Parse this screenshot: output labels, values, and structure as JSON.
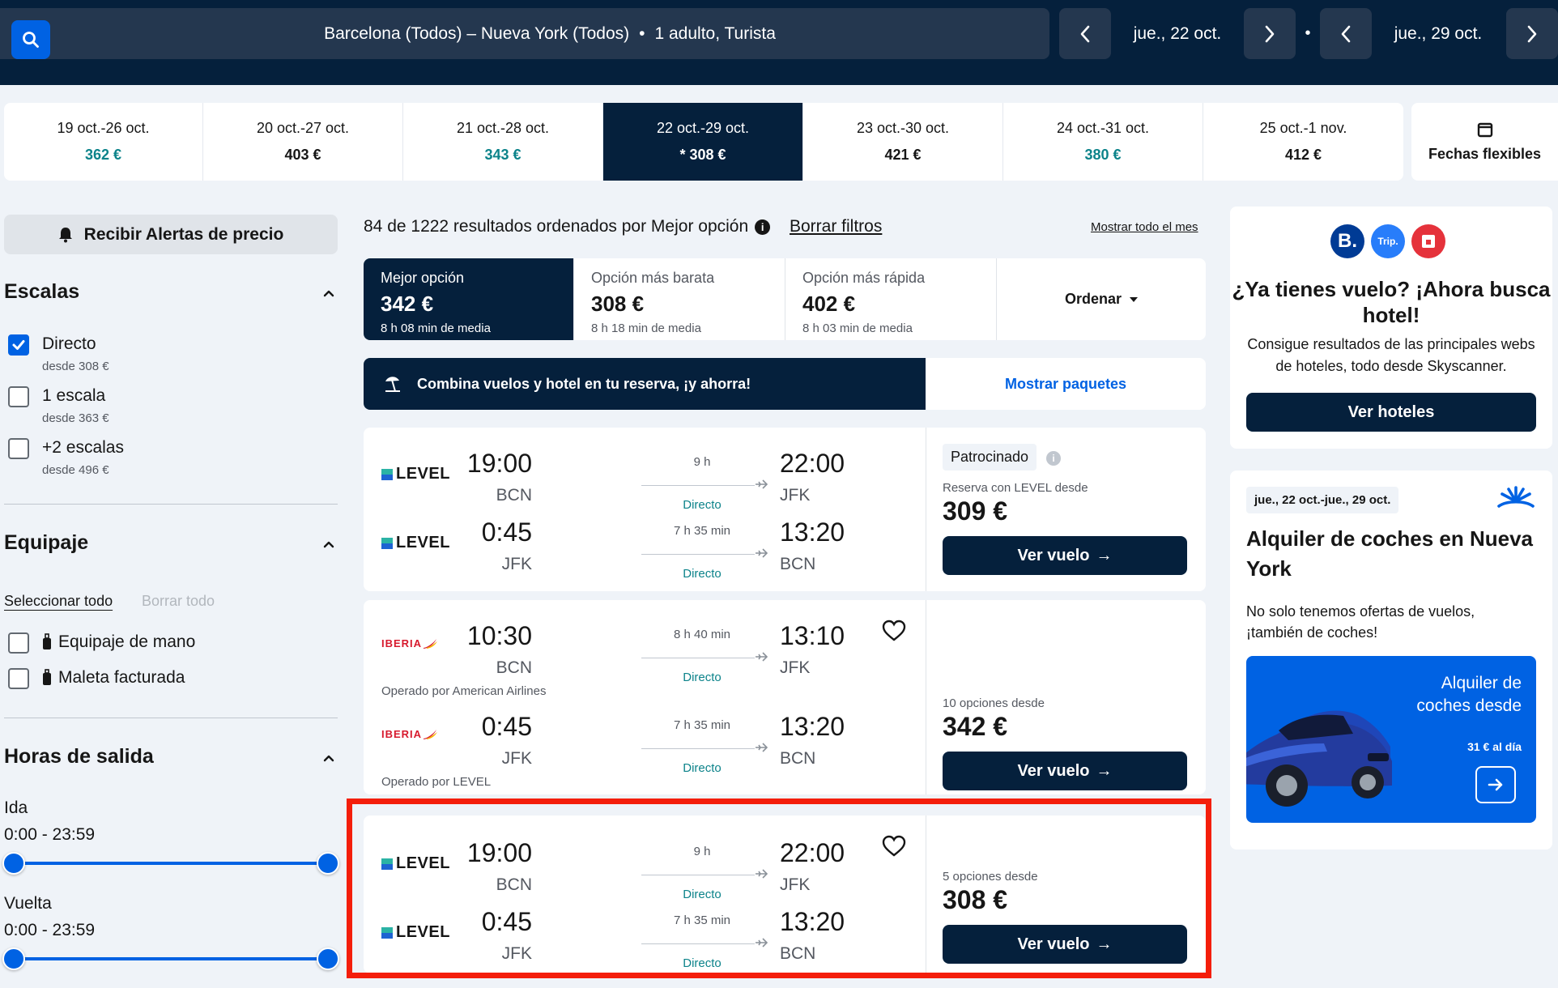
{
  "header": {
    "search_summary": "Barcelona (Todos) – Nueva York (Todos)",
    "dot": "•",
    "travellers": "1 adulto, Turista",
    "outbound_date": "jue., 22 oct.",
    "return_date": "jue., 29 oct.",
    "separator": "•"
  },
  "date_strip": [
    {
      "range": "19 oct.-26 oct.",
      "price": "362 €",
      "color": "green"
    },
    {
      "range": "20 oct.-27 oct.",
      "price": "403 €",
      "color": "black"
    },
    {
      "range": "21 oct.-28 oct.",
      "price": "343 €",
      "color": "green"
    },
    {
      "range": "22 oct.-29 oct.",
      "price": "* 308 €",
      "color": "selected"
    },
    {
      "range": "23 oct.-30 oct.",
      "price": "421 €",
      "color": "black"
    },
    {
      "range": "24 oct.-31 oct.",
      "price": "380 €",
      "color": "green"
    },
    {
      "range": "25 oct.-1 nov.",
      "price": "412 €",
      "color": "black"
    }
  ],
  "flexible_dates": "Fechas flexibles",
  "sidebar": {
    "price_alerts": "Recibir Alertas de precio",
    "stops_title": "Escalas",
    "stops": [
      {
        "label": "Directo",
        "from": "desde 308 €",
        "checked": true
      },
      {
        "label": "1 escala",
        "from": "desde 363 €",
        "checked": false
      },
      {
        "label": "+2 escalas",
        "from": "desde 496 €",
        "checked": false
      }
    ],
    "baggage_title": "Equipaje",
    "select_all": "Seleccionar todo",
    "clear_all": "Borrar todo",
    "baggage": [
      {
        "label": "Equipaje de mano"
      },
      {
        "label": "Maleta facturada"
      }
    ],
    "times_title": "Horas de salida",
    "outbound_label": "Ida",
    "outbound_range": "0:00 - 23:59",
    "return_label": "Vuelta",
    "return_range": "0:00 - 23:59"
  },
  "results": {
    "count_text": "84 de 1222 resultados ordenados por Mejor opción",
    "clear_filters": "Borrar filtros",
    "show_month": "Mostrar todo el mes",
    "sort_tabs": [
      {
        "title": "Mejor opción",
        "price": "342 €",
        "sub": "8 h 08 min de media"
      },
      {
        "title": "Opción más barata",
        "price": "308 €",
        "sub": "8 h 18 min de media"
      },
      {
        "title": "Opción más rápida",
        "price": "402 €",
        "sub": "8 h 03 min de media"
      }
    ],
    "order_label": "Ordenar",
    "package_text": "Combina vuelos y hotel en tu reserva, ¡y ahorra!",
    "package_link": "Mostrar paquetes"
  },
  "cards": [
    {
      "legs": [
        {
          "airline": "LEVEL",
          "dep_time": "19:00",
          "dep_code": "BCN",
          "duration": "9 h",
          "stops": "Directo",
          "arr_time": "22:00",
          "arr_code": "JFK"
        },
        {
          "airline": "LEVEL",
          "dep_time": "0:45",
          "dep_code": "JFK",
          "duration": "7 h 35 min",
          "stops": "Directo",
          "arr_time": "13:20",
          "arr_code": "BCN"
        }
      ],
      "sponsored": "Patrocinado",
      "sponsor_info": "i",
      "price_caption": "Reserva con LEVEL desde",
      "price": "309 €",
      "button": "Ver vuelo"
    },
    {
      "legs": [
        {
          "airline": "IBERIA",
          "dep_time": "10:30",
          "dep_code": "BCN",
          "duration": "8 h 40 min",
          "stops": "Directo",
          "arr_time": "13:10",
          "arr_code": "JFK",
          "operated": "Operado por American Airlines"
        },
        {
          "airline": "IBERIA",
          "dep_time": "0:45",
          "dep_code": "JFK",
          "duration": "7 h 35 min",
          "stops": "Directo",
          "arr_time": "13:20",
          "arr_code": "BCN",
          "operated": "Operado por LEVEL"
        }
      ],
      "price_caption": "10 opciones desde",
      "price": "342 €",
      "button": "Ver vuelo"
    },
    {
      "legs": [
        {
          "airline": "LEVEL",
          "dep_time": "19:00",
          "dep_code": "BCN",
          "duration": "9 h",
          "stops": "Directo",
          "arr_time": "22:00",
          "arr_code": "JFK"
        },
        {
          "airline": "LEVEL",
          "dep_time": "0:45",
          "dep_code": "JFK",
          "duration": "7 h 35 min",
          "stops": "Directo",
          "arr_time": "13:20",
          "arr_code": "BCN"
        }
      ],
      "price_caption": "5 opciones desde",
      "price": "308 €",
      "button": "Ver vuelo"
    }
  ],
  "hotel_promo": {
    "logo_b": "B.",
    "logo_trip": "Trip.",
    "title": "¿Ya tienes vuelo? ¡Ahora busca hotel!",
    "subtitle": "Consigue resultados de las principales webs de hoteles, todo desde Skyscanner.",
    "button": "Ver hoteles"
  },
  "car_promo": {
    "dates": "jue., 22 oct.-jue., 29 oct.",
    "title": "Alquiler de coches en Nueva York",
    "subtitle": "No solo tenemos ofertas de vuelos, ¡también de coches!",
    "promo_title": "Alquiler de coches desde",
    "promo_price": "31 € al día"
  },
  "colors": {
    "navy": "#05203c",
    "blue": "#0062e3",
    "green_price": "#0c838a",
    "highlight": "#f41e0b"
  }
}
